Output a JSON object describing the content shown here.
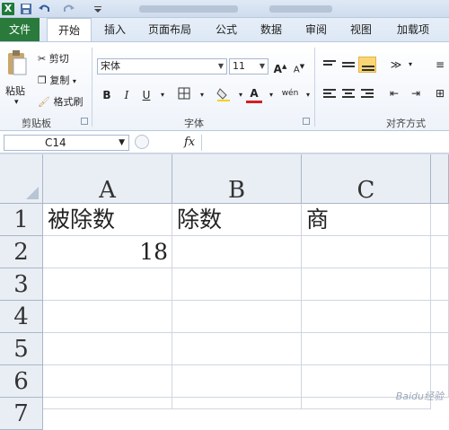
{
  "quick_access": {
    "logo_letter": "X"
  },
  "tabs": [
    {
      "label": "文件"
    },
    {
      "label": "开始"
    },
    {
      "label": "插入"
    },
    {
      "label": "页面布局"
    },
    {
      "label": "公式"
    },
    {
      "label": "数据"
    },
    {
      "label": "审阅"
    },
    {
      "label": "视图"
    },
    {
      "label": "加载项"
    }
  ],
  "clipboard": {
    "paste_label": "粘贴",
    "cut_label": "剪切",
    "copy_label": "复制",
    "format_painter_label": "格式刷",
    "group_label": "剪贴板"
  },
  "font": {
    "name": "宋体",
    "size": "11",
    "bold": "B",
    "italic": "I",
    "underline": "U",
    "grow": "A",
    "shrink": "A",
    "phonetic": "wén",
    "group_label": "字体",
    "font_color": "#d22020",
    "fill_color": "#f5d21b"
  },
  "alignment": {
    "group_label": "对齐方式"
  },
  "formula_bar": {
    "name_box": "C14",
    "fx": "fx",
    "formula": ""
  },
  "sheet": {
    "columns": [
      "A",
      "B",
      "C"
    ],
    "rows": [
      "1",
      "2",
      "3",
      "4",
      "5",
      "6",
      "7"
    ],
    "cells": {
      "A1": "被除数",
      "B1": "除数",
      "C1": "商",
      "A2": "18"
    }
  },
  "watermark": "Baidu经验"
}
